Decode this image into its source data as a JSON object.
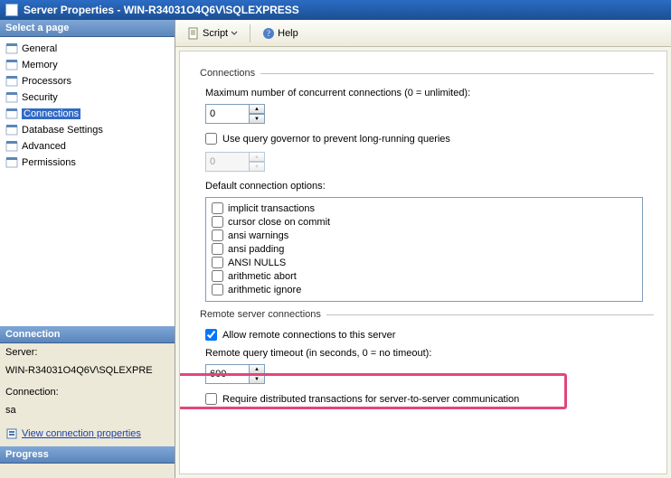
{
  "window": {
    "title": "Server Properties - WIN-R34031O4Q6V\\SQLEXPRESS"
  },
  "toolbar": {
    "script_label": "Script",
    "help_label": "Help"
  },
  "sidebar": {
    "select_header": "Select a page",
    "items": [
      {
        "label": "General"
      },
      {
        "label": "Memory"
      },
      {
        "label": "Processors"
      },
      {
        "label": "Security"
      },
      {
        "label": "Connections"
      },
      {
        "label": "Database Settings"
      },
      {
        "label": "Advanced"
      },
      {
        "label": "Permissions"
      }
    ],
    "connection_header": "Connection",
    "server_label": "Server:",
    "server_value": "WIN-R34031O4Q6V\\SQLEXPRE",
    "conn_label": "Connection:",
    "conn_value": "sa",
    "view_props_link": "View connection properties",
    "progress_header": "Progress"
  },
  "main": {
    "group_connections": "Connections",
    "max_conn_label": "Maximum number of concurrent connections (0 = unlimited):",
    "max_conn_value": "0",
    "use_governor_label": "Use query governor to prevent long-running queries",
    "governor_value": "0",
    "default_opts_label": "Default connection options:",
    "options": [
      {
        "label": "implicit transactions",
        "checked": false
      },
      {
        "label": "cursor close on commit",
        "checked": false
      },
      {
        "label": "ansi warnings",
        "checked": false
      },
      {
        "label": "ansi padding",
        "checked": false
      },
      {
        "label": "ANSI NULLS",
        "checked": false
      },
      {
        "label": "arithmetic abort",
        "checked": false
      },
      {
        "label": "arithmetic ignore",
        "checked": false
      }
    ],
    "group_remote": "Remote server connections",
    "allow_remote_label": "Allow remote connections to this server",
    "remote_timeout_label": "Remote query timeout (in seconds, 0 = no timeout):",
    "remote_timeout_value": "600",
    "require_dist_label": "Require distributed transactions for server-to-server communication"
  }
}
